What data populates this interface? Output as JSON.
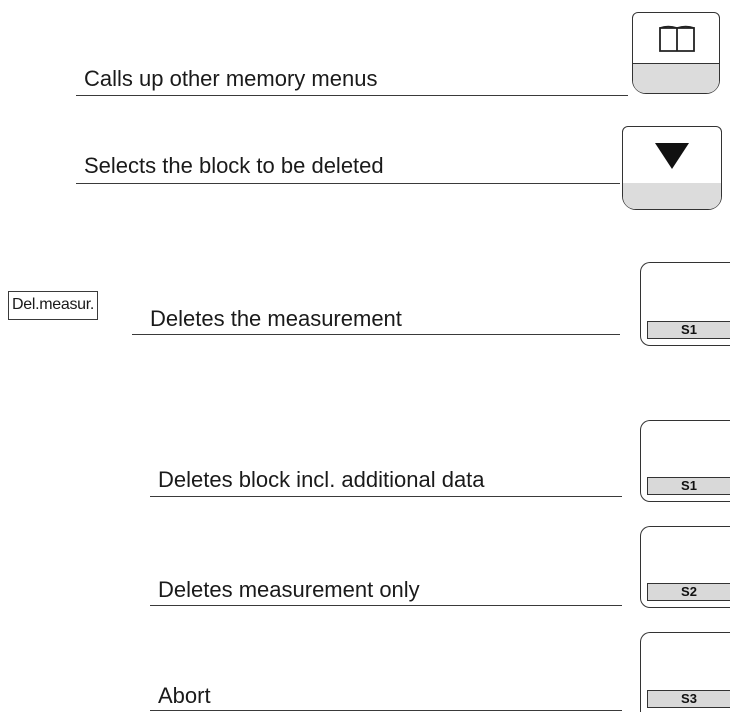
{
  "rows": [
    {
      "text": "Calls up other memory menus",
      "key": "book-icon"
    },
    {
      "text": "Selects the block to be deleted",
      "key": "down-triangle-icon"
    },
    {
      "label": "Del.measur.",
      "text": "Deletes the measurement",
      "key": "S1"
    },
    {
      "text": "Deletes block incl. additional data",
      "key": "S1"
    },
    {
      "text": "Deletes measurement only",
      "key": "S2"
    },
    {
      "text": "Abort",
      "key": "S3"
    }
  ]
}
